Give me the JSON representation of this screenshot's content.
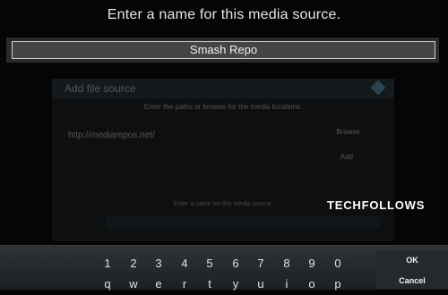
{
  "dialog": {
    "prompt": "Enter a name for this media source.",
    "name_value": "Smash Repo"
  },
  "background_dialog": {
    "title": "Add file source",
    "instruction": "Enter the paths or browse for the media locations.",
    "path": "http://mediarepos.net/",
    "browse_label": "Browse",
    "add_label": "Add",
    "footer_text": "Enter a name for this media source."
  },
  "watermark": "TECHFOLLOWS",
  "keyboard": {
    "numbers": [
      "1",
      "2",
      "3",
      "4",
      "5",
      "6",
      "7",
      "8",
      "9",
      "0"
    ],
    "letters": [
      "q",
      "w",
      "e",
      "r",
      "t",
      "y",
      "u",
      "i",
      "o",
      "p"
    ],
    "ok_label": "OK",
    "cancel_label": "Cancel"
  }
}
